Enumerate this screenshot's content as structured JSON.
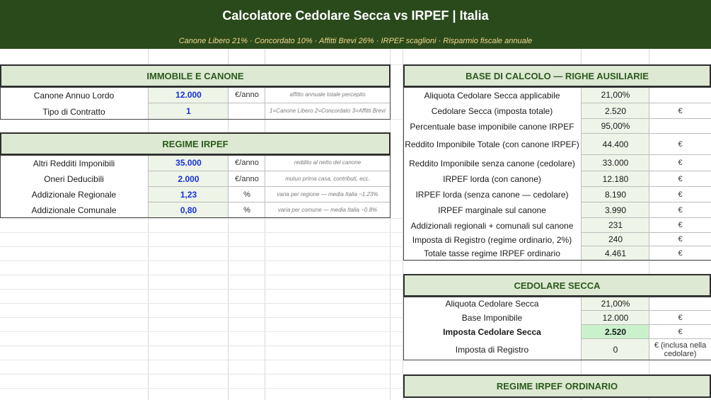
{
  "header": {
    "title": "Calcolatore Cedolare Secca vs IRPEF  |  Italia",
    "subtitle": "Canone Libero 21% · Concordato 10% · Affitti Brevi 26% · IRPEF scaglioni · Risparmio fiscale annuale"
  },
  "immobile": {
    "title": "IMMOBILE E CANONE",
    "rows": [
      {
        "label": "Canone Annuo Lordo",
        "value": "12.000",
        "unit": "€/anno",
        "note": "affitto annuale totale percepito"
      },
      {
        "label": "Tipo di Contratto",
        "value": "1",
        "unit": "",
        "note": "1=Canone Libero  2=Concordato  3=Affitti Brevi"
      }
    ]
  },
  "irpef": {
    "title": "REGIME IRPEF",
    "rows": [
      {
        "label": "Altri Redditi Imponibili",
        "value": "35.000",
        "unit": "€/anno",
        "note": "reddito al netto del canone"
      },
      {
        "label": "Oneri Deducibili",
        "value": "2.000",
        "unit": "€/anno",
        "note": "mutuo prima casa, contributi, ecc."
      },
      {
        "label": "Addizionale Regionale",
        "value": "1,23",
        "unit": "%",
        "note": "varia per regione — media Italia ~1.23%"
      },
      {
        "label": "Addizionale Comunale",
        "value": "0,80",
        "unit": "%",
        "note": "varia per comune — media Italia ~0.8%"
      }
    ]
  },
  "base": {
    "title": "BASE DI CALCOLO — RIGHE AUSILIARIE",
    "rows": [
      {
        "label": "Aliquota Cedolare Secca applicabile",
        "value": "21,00%",
        "unit": ""
      },
      {
        "label": "Cedolare Secca (imposta totale)",
        "value": "2.520",
        "unit": "€"
      },
      {
        "label": "Percentuale base imponibile canone IRPEF",
        "value": "95,00%",
        "unit": ""
      },
      {
        "label": "Reddito Imponibile Totale (con canone IRPEF)",
        "value": "44.400",
        "unit": "€"
      },
      {
        "label": "Reddito Imponibile senza canone (cedolare)",
        "value": "33.000",
        "unit": "€"
      },
      {
        "label": "IRPEF lorda (con canone)",
        "value": "12.180",
        "unit": "€"
      },
      {
        "label": "IRPEF lorda (senza canone — cedolare)",
        "value": "8.190",
        "unit": "€"
      },
      {
        "label": "IRPEF marginale sul canone",
        "value": "3.990",
        "unit": "€"
      },
      {
        "label": "Addizionali regionali + comunali sul canone",
        "value": "231",
        "unit": "€"
      },
      {
        "label": "Imposta di Registro (regime ordinario, 2%)",
        "value": "240",
        "unit": "€"
      },
      {
        "label": "Totale tasse regime IRPEF ordinario",
        "value": "4.461",
        "unit": "€"
      }
    ]
  },
  "cedolare": {
    "title": "CEDOLARE SECCA",
    "rows": [
      {
        "label": "Aliquota Cedolare Secca",
        "value": "21,00%",
        "unit": ""
      },
      {
        "label": "Base Imponibile",
        "value": "12.000",
        "unit": "€"
      },
      {
        "label": "Imposta Cedolare Secca",
        "value": "2.520",
        "unit": "€"
      },
      {
        "label": "Imposta di Registro",
        "value": "0",
        "unit": "€ (inclusa nella cedolare)"
      }
    ]
  },
  "ordinario": {
    "title": "REGIME IRPEF ORDINARIO"
  }
}
